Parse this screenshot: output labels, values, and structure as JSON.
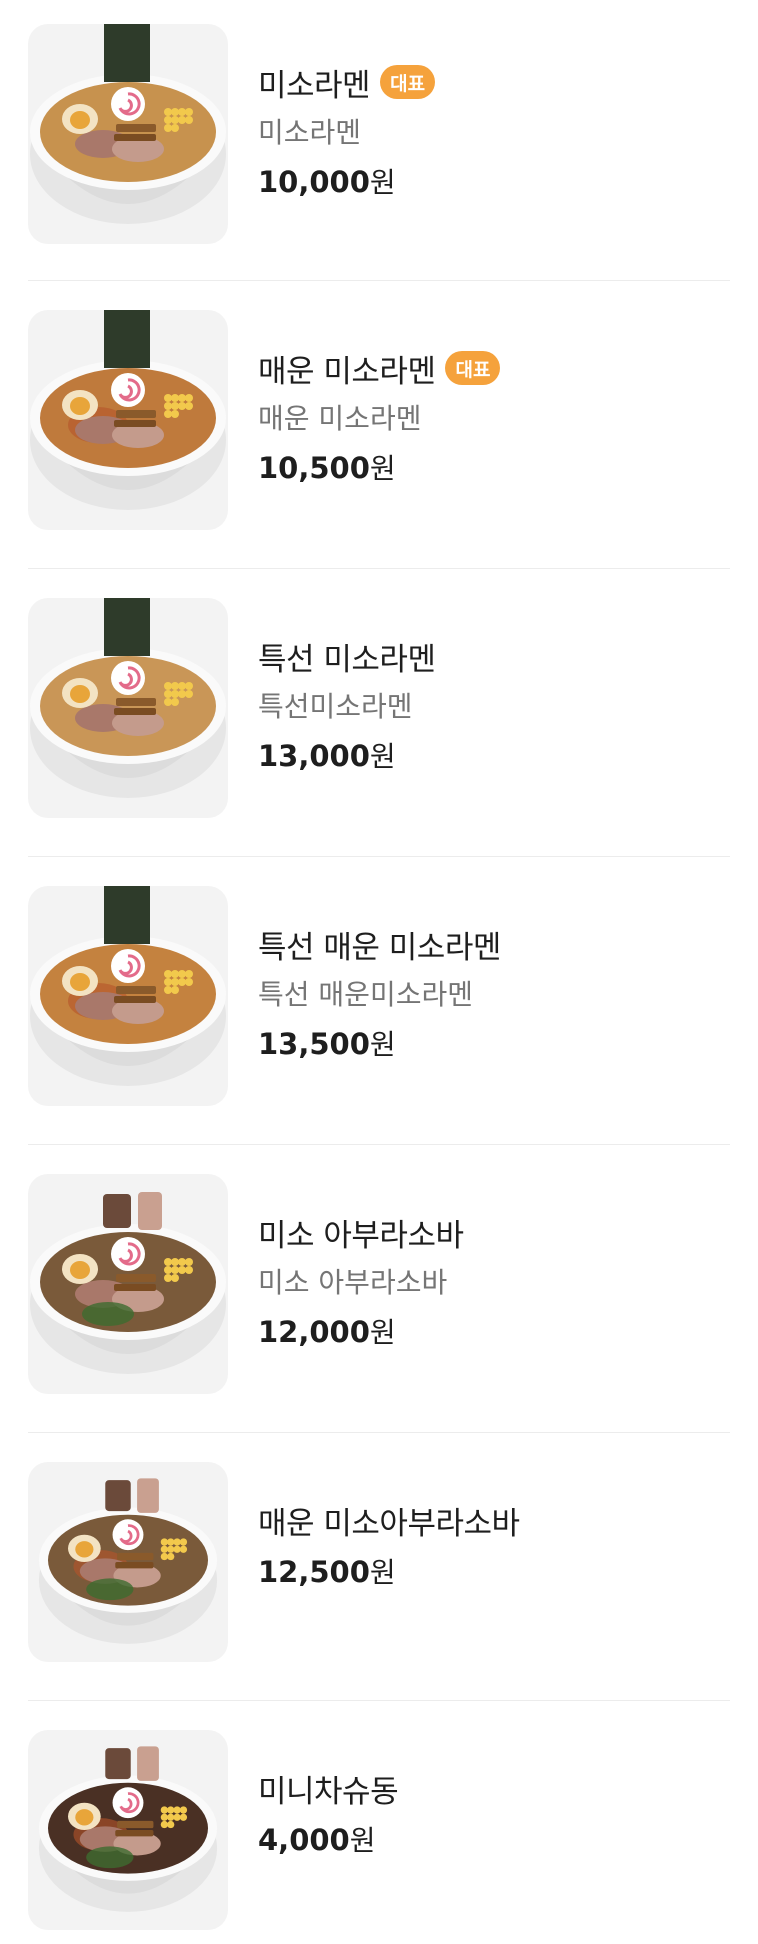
{
  "items": [
    {
      "name": "미소라멘",
      "badge": "대표",
      "desc": "미소라멘",
      "price": "10,000",
      "unit": "원",
      "image": "miso-ramen-photo",
      "broth": "#c7924e",
      "spicy": false,
      "hasNori": true
    },
    {
      "name": "매운 미소라멘",
      "badge": "대표",
      "desc": "매운 미소라멘",
      "price": "10,500",
      "unit": "원",
      "image": "spicy-miso-ramen-photo",
      "broth": "#bf7a3c",
      "spicy": true,
      "hasNori": true
    },
    {
      "name": "특선 미소라멘",
      "badge": "",
      "desc": "특선미소라멘",
      "price": "13,000",
      "unit": "원",
      "image": "special-miso-ramen-photo",
      "broth": "#c99657",
      "spicy": false,
      "hasNori": true
    },
    {
      "name": "특선 매운 미소라멘",
      "badge": "",
      "desc": "특선 매운미소라멘",
      "price": "13,500",
      "unit": "원",
      "image": "special-spicy-miso-ramen-photo",
      "broth": "#c4823f",
      "spicy": true,
      "hasNori": true
    },
    {
      "name": "미소 아부라소바",
      "badge": "",
      "desc": "미소 아부라소바",
      "price": "12,000",
      "unit": "원",
      "image": "miso-aburasoba-photo",
      "broth": "#7a5a3a",
      "spicy": false,
      "hasNori": false
    },
    {
      "name": "매운 미소아부라소바",
      "badge": "",
      "desc": "",
      "price": "12,500",
      "unit": "원",
      "image": "spicy-miso-aburasoba-photo",
      "broth": "#7a5a3a",
      "spicy": true,
      "hasNori": false
    },
    {
      "name": "미니차슈동",
      "badge": "",
      "desc": "",
      "price": "4,000",
      "unit": "원",
      "image": "mini-chashu-don-photo",
      "broth": "#4a3024",
      "spicy": true,
      "hasNori": false
    }
  ],
  "colors": {
    "badge": "#f5a23c",
    "divider": "#ececec",
    "name": "#1e1e1e",
    "desc": "#757575"
  }
}
